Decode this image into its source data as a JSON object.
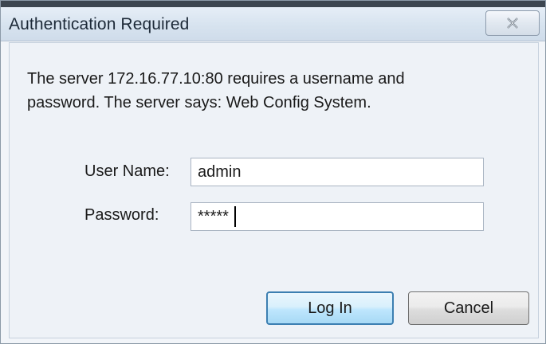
{
  "dialog": {
    "title": "Authentication Required",
    "close_icon": "close-x-icon",
    "message_line1": "The server 172.16.77.10:80 requires a username and",
    "message_line2": "password. The server says: Web Config System.",
    "username_label": "User Name:",
    "username_value": "admin",
    "password_label": "Password:",
    "password_value": "*****",
    "login_label": "Log In",
    "cancel_label": "Cancel"
  },
  "colors": {
    "titlebar": "#d7e3ef",
    "window_bg": "#eef2f7",
    "default_button_border": "#3c7fb1"
  }
}
